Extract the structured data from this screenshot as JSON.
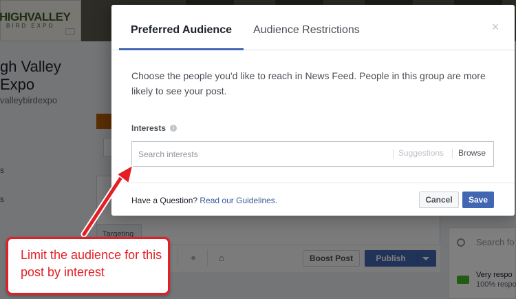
{
  "background": {
    "logo_main": "HIGHVALLEY",
    "logo_sub": "BIRD EXPO",
    "page_name": "gh Valley\nExpo",
    "page_handle": "valleybirdexpo",
    "targeting_tab": "Targeting",
    "boost_post_label": "Boost Post",
    "publish_label": "Publish",
    "right_search_placeholder": "Search fo",
    "responsive_line1": "Very respo",
    "responsive_line2": "100% respo",
    "left_fragment_1": "s",
    "left_fragment_2": "s"
  },
  "modal": {
    "tabs": [
      {
        "label": "Preferred Audience",
        "active": true
      },
      {
        "label": "Audience Restrictions",
        "active": false
      }
    ],
    "close_icon": "×",
    "description": "Choose the people you'd like to reach in News Feed. People in this group are more likely to see your post.",
    "interests_label": "Interests",
    "info_icon": "i",
    "search": {
      "placeholder": "Search interests",
      "value": ""
    },
    "suggestions_label": "Suggestions",
    "browse_label": "Browse",
    "footer": {
      "question": "Have a Question?",
      "guidelines_link": "Read our Guidelines.",
      "cancel_label": "Cancel",
      "save_label": "Save"
    }
  },
  "callout": {
    "text": "Limit the audience for this post by interest"
  },
  "colors": {
    "accent": "#4267b2",
    "callout_red": "#e31e24",
    "link": "#365899"
  }
}
